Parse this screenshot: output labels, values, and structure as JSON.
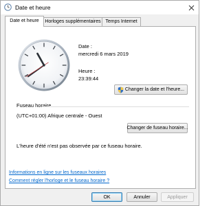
{
  "window": {
    "title": "Date et heure"
  },
  "tabs": [
    {
      "label": "Date et heure",
      "active": true
    },
    {
      "label": "Horloges supplémentaires",
      "active": false
    },
    {
      "label": "Temps Internet",
      "active": false
    }
  ],
  "datetime": {
    "date_label": "Date :",
    "date_value": "mercredi 6 mars 2019",
    "time_label": "Heure :",
    "time_value": "23:39:44",
    "change_button": "Changer la date et l'heure..."
  },
  "timezone": {
    "section_label": "Fuseau horaire",
    "value": "(UTC+01:00) Afrique centrale - Ouest",
    "change_button": "Changer de fuseau horaire...",
    "dst_note": "L'heure d'été n'est pas observée par ce fuseau horaire."
  },
  "links": [
    "Informations en ligne sur les fuseaux horaires",
    "Comment régler l'horloge et le fuseau horaire ?"
  ],
  "footer": {
    "ok": "OK",
    "cancel": "Annuler",
    "apply": "Appliquer"
  },
  "icons": {
    "title": "clock-icon",
    "close": "close-icon",
    "shield": "uac-shield-icon"
  },
  "colors": {
    "link": "#0066cc",
    "accent": "#3c7fb1"
  }
}
